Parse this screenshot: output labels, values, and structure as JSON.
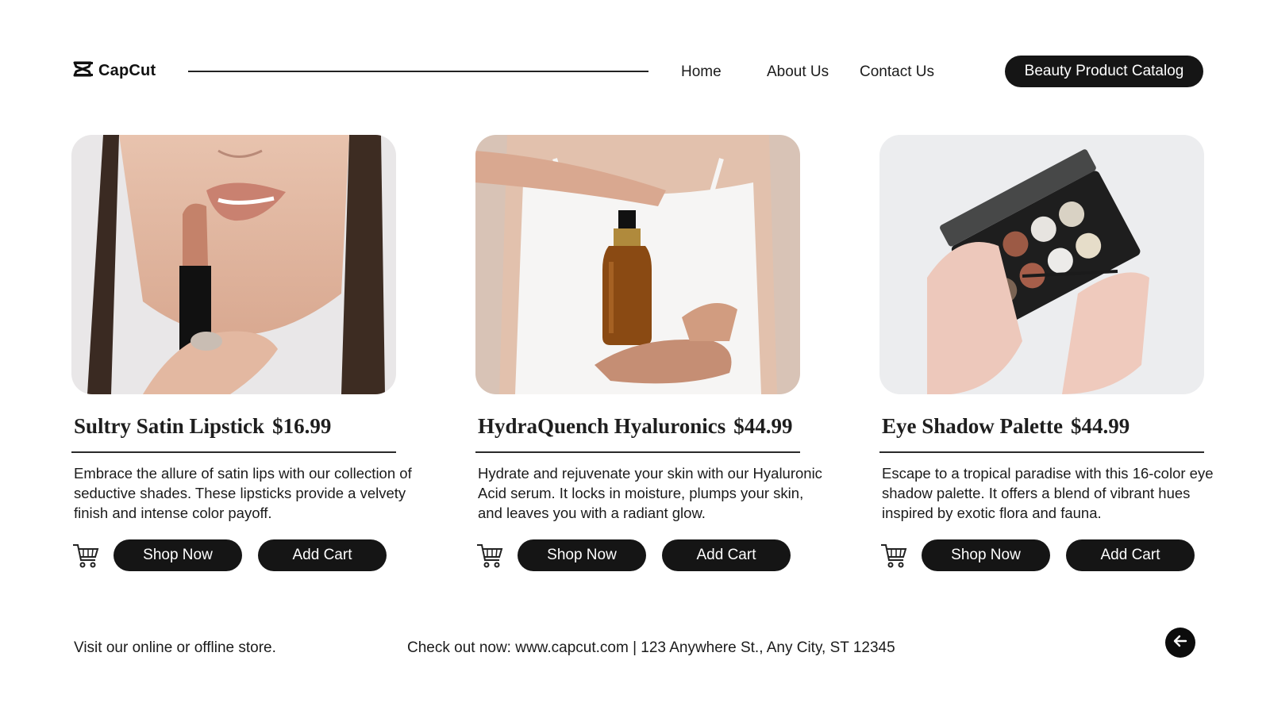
{
  "header": {
    "logo_text": "CapCut",
    "nav": {
      "home": "Home",
      "about": "About Us",
      "contact": "Contact Us"
    },
    "catalog_button": "Beauty Product Catalog"
  },
  "products": [
    {
      "name": "Sultry Satin Lipstick",
      "price": "$16.99",
      "description": "Embrace the allure of satin lips with our collection of seductive shades. These lipsticks provide a velvety finish and intense color payoff.",
      "shop_label": "Shop Now",
      "cart_label": "Add Cart"
    },
    {
      "name": "HydraQuench Hyaluronics",
      "price": "$44.99",
      "description": "Hydrate and rejuvenate your skin with our Hyaluronic Acid serum. It locks in moisture, plumps your skin, and leaves you with a radiant glow.",
      "shop_label": "Shop Now",
      "cart_label": "Add Cart"
    },
    {
      "name": "Eye Shadow Palette",
      "price": "$44.99",
      "description": "Escape to a tropical paradise with this 16-color eye shadow palette. It offers a blend of vibrant hues inspired by exotic flora and fauna.",
      "shop_label": "Shop Now",
      "cart_label": "Add Cart"
    }
  ],
  "footer": {
    "left_text": "Visit our online or offline store.",
    "info_text": "Check out now: www.capcut.com | 123 Anywhere St., Any City, ST 12345"
  },
  "icons": [
    "capcut-logo-icon",
    "cart-icon",
    "arrow-left-icon"
  ],
  "colors": {
    "button_bg": "#151515",
    "button_text": "#ffffff",
    "text": "#1b1b1b",
    "background": "#ffffff"
  }
}
